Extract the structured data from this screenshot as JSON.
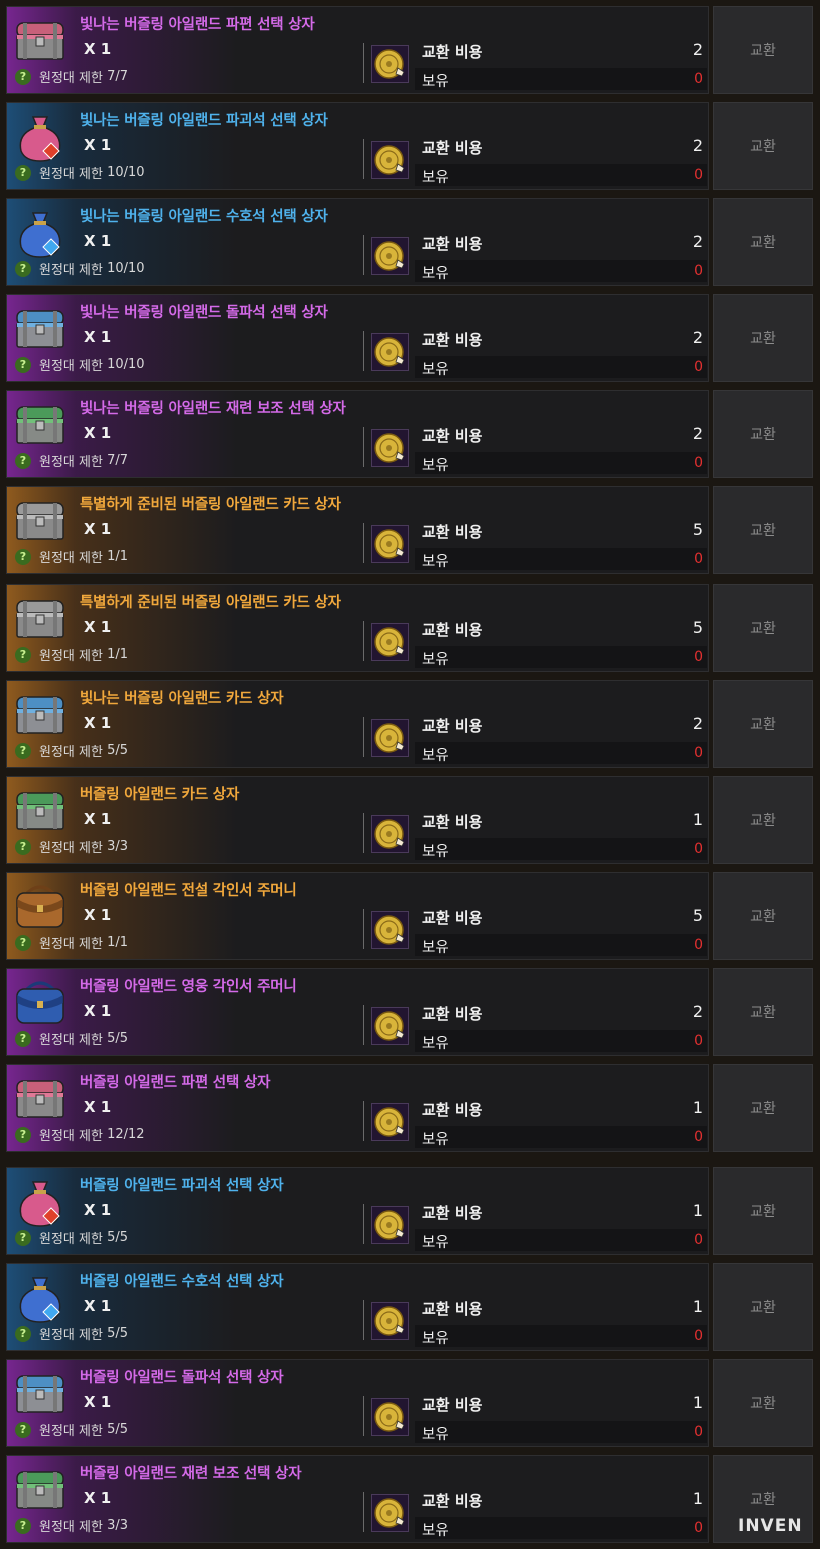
{
  "common": {
    "cost_label": "교환 비용",
    "owned_label": "보유",
    "exchange_label": "교환",
    "limit_prefix": "원정대 제한"
  },
  "watermark": "INVEN",
  "items": [
    {
      "name": "빛나는 버즐링 아일랜드 파편 선택 상자",
      "qty": "X 1",
      "limit": "7/7",
      "cost": "2",
      "owned": "0",
      "rarity": "purple",
      "icon": "pink-chest-icon"
    },
    {
      "name": "빛나는 버즐링 아일랜드 파괴석 선택 상자",
      "qty": "X 1",
      "limit": "10/10",
      "cost": "2",
      "owned": "0",
      "rarity": "blue",
      "icon": "pink-pouch-icon"
    },
    {
      "name": "빛나는 버즐링 아일랜드 수호석 선택 상자",
      "qty": "X 1",
      "limit": "10/10",
      "cost": "2",
      "owned": "0",
      "rarity": "blue",
      "icon": "blue-pouch-icon"
    },
    {
      "name": "빛나는 버즐링 아일랜드 돌파석 선택 상자",
      "qty": "X 1",
      "limit": "10/10",
      "cost": "2",
      "owned": "0",
      "rarity": "purple",
      "icon": "blue-chest-icon"
    },
    {
      "name": "빛나는 버즐링 아일랜드 재련 보조 선택 상자",
      "qty": "X 1",
      "limit": "7/7",
      "cost": "2",
      "owned": "0",
      "rarity": "purple",
      "icon": "green-chest-icon"
    },
    {
      "name": "특별하게 준비된 버즐링 아일랜드 카드 상자",
      "qty": "X 1",
      "limit": "1/1",
      "cost": "5",
      "owned": "0",
      "rarity": "orange",
      "icon": "gray-chest-icon"
    },
    {
      "name": "특별하게 준비된 버즐링 아일랜드 카드 상자",
      "qty": "X 1",
      "limit": "1/1",
      "cost": "5",
      "owned": "0",
      "rarity": "orange",
      "icon": "gray-chest-icon"
    },
    {
      "name": "빛나는 버즐링 아일랜드 카드 상자",
      "qty": "X 1",
      "limit": "5/5",
      "cost": "2",
      "owned": "0",
      "rarity": "orange",
      "icon": "blue-chest-icon"
    },
    {
      "name": "버즐링 아일랜드 카드 상자",
      "qty": "X 1",
      "limit": "3/3",
      "cost": "1",
      "owned": "0",
      "rarity": "orange",
      "icon": "green-chest-icon"
    },
    {
      "name": "버즐링 아일랜드 전설 각인서 주머니",
      "qty": "X 1",
      "limit": "1/1",
      "cost": "5",
      "owned": "0",
      "rarity": "orange",
      "icon": "brown-bag-icon"
    },
    {
      "name": "버즐링 아일랜드 영웅 각인서 주머니",
      "qty": "X 1",
      "limit": "5/5",
      "cost": "2",
      "owned": "0",
      "rarity": "purple",
      "icon": "blue-bag-icon"
    },
    {
      "name": "버즐링 아일랜드 파편 선택 상자",
      "qty": "X 1",
      "limit": "12/12",
      "cost": "1",
      "owned": "0",
      "rarity": "purple",
      "icon": "pink-chest-icon"
    },
    {
      "name": "버즐링 아일랜드 파괴석 선택 상자",
      "qty": "X 1",
      "limit": "5/5",
      "cost": "1",
      "owned": "0",
      "rarity": "blue",
      "icon": "pink-pouch-icon"
    },
    {
      "name": "버즐링 아일랜드 수호석 선택 상자",
      "qty": "X 1",
      "limit": "5/5",
      "cost": "1",
      "owned": "0",
      "rarity": "blue",
      "icon": "blue-pouch-icon"
    },
    {
      "name": "버즐링 아일랜드 돌파석 선택 상자",
      "qty": "X 1",
      "limit": "5/5",
      "cost": "1",
      "owned": "0",
      "rarity": "purple",
      "icon": "blue-chest-icon"
    },
    {
      "name": "버즐링 아일랜드 재련 보조 선택 상자",
      "qty": "X 1",
      "limit": "3/3",
      "cost": "1",
      "owned": "0",
      "rarity": "purple",
      "icon": "green-chest-icon"
    }
  ],
  "colors": {
    "purple_name": "#d46ae8",
    "blue_name": "#4fb2ec",
    "orange_name": "#f1a83c",
    "owned_zero": "#e33030"
  }
}
